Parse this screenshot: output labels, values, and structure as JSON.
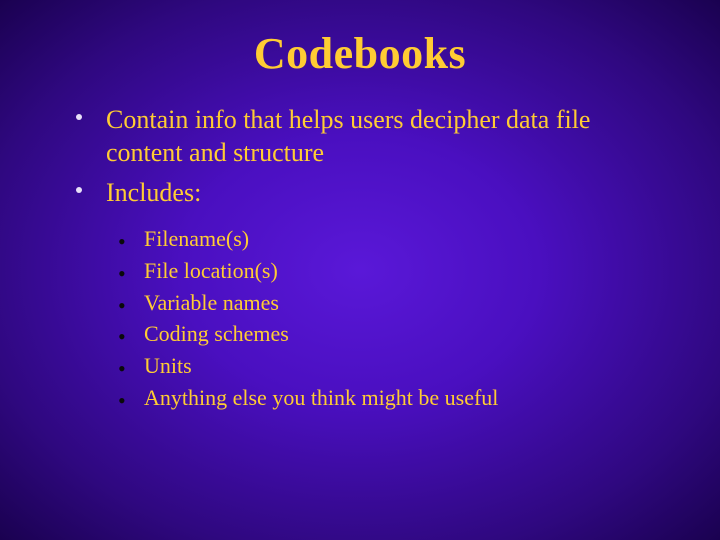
{
  "title": "Codebooks",
  "main_points": [
    "Contain info that helps users decipher data file content and structure",
    "Includes:"
  ],
  "sub_points": [
    "Filename(s)",
    "File location(s)",
    "Variable names",
    "Coding schemes",
    "Units",
    "Anything else you think might be useful"
  ]
}
